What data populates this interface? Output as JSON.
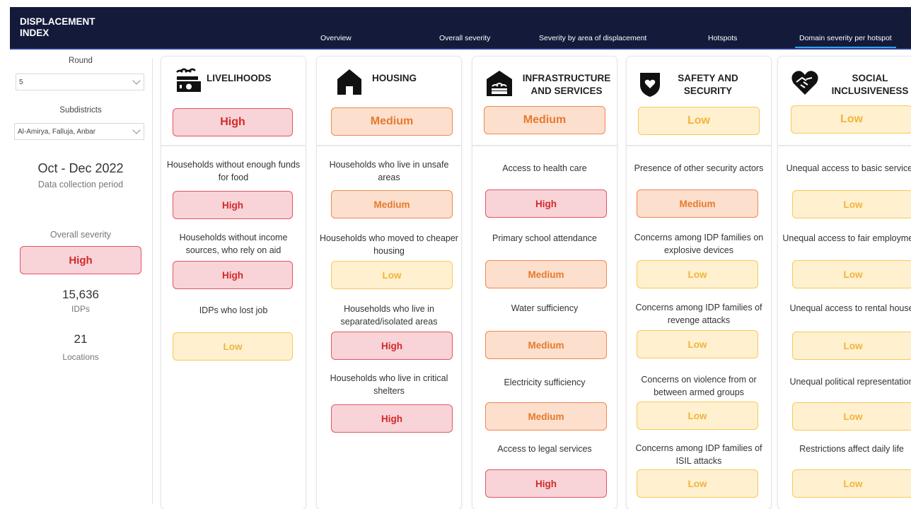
{
  "header": {
    "title_line1": "DISPLACEMENT",
    "title_line2": "INDEX",
    "tabs": [
      "Overview",
      "Overall severity",
      "Severity by area of displacement",
      "Hotspots",
      "Domain severity per hotspot"
    ],
    "active_tab": "Domain severity per hotspot"
  },
  "filters": {
    "round_label": "Round",
    "round_value": "5",
    "subdistricts_label": "Subdistricts",
    "subdistricts_value": "Al-Amirya, Falluja, Anbar"
  },
  "summary": {
    "period": "Oct - Dec 2022",
    "period_label": "Data collection period",
    "overall_label": "Overall severity",
    "overall_value": "High",
    "idps_value": "15,636",
    "idps_label": "IDPs",
    "locations_value": "21",
    "locations_label": "Locations"
  },
  "domains": [
    {
      "title_line1": "LIVELIHOODS",
      "title_line2": "",
      "severity": "High",
      "icon": "money-wheat-icon",
      "indicators": [
        {
          "text": "Households without enough funds for food",
          "value": "High"
        },
        {
          "text": "Households without income sources, who rely on aid",
          "value": "High"
        },
        {
          "text": "IDPs who lost job",
          "value": "Low"
        }
      ]
    },
    {
      "title_line1": "HOUSING",
      "title_line2": "",
      "severity": "Medium",
      "icon": "house-icon",
      "indicators": [
        {
          "text": "Households who live in unsafe areas",
          "value": "Medium"
        },
        {
          "text": "Households who moved to cheaper housing",
          "value": "Low"
        },
        {
          "text": "Households who live in separated/isolated areas",
          "value": "High"
        },
        {
          "text": "Households who live in critical shelters",
          "value": "High"
        }
      ]
    },
    {
      "title_line1": "INFRASTRUCTURE",
      "title_line2": "AND SERVICES",
      "severity": "Medium",
      "icon": "infrastructure-icon",
      "indicators": [
        {
          "text": "Access to health care",
          "value": "High"
        },
        {
          "text": "Primary school attendance",
          "value": "Medium"
        },
        {
          "text": "Water sufficiency",
          "value": "Medium"
        },
        {
          "text": "Electricity sufficiency",
          "value": "Medium"
        },
        {
          "text": "Access to legal services",
          "value": "High"
        }
      ]
    },
    {
      "title_line1": "SAFETY AND",
      "title_line2": "SECURITY",
      "severity": "Low",
      "icon": "shield-heart-icon",
      "indicators": [
        {
          "text": "Presence of other security actors",
          "value": "Medium"
        },
        {
          "text": "Concerns among IDP families on explosive devices",
          "value": "Low"
        },
        {
          "text": "Concerns among IDP families of revenge attacks",
          "value": "Low"
        },
        {
          "text": "Concerns on violence from or between armed groups",
          "value": "Low"
        },
        {
          "text": "Concerns among IDP families of ISIL attacks",
          "value": "Low"
        }
      ]
    },
    {
      "title_line1": "SOCIAL",
      "title_line2": "INCLUSIVENESS",
      "severity": "Low",
      "icon": "handshake-heart-icon",
      "indicators": [
        {
          "text": "Unequal access to basic services",
          "value": "Low"
        },
        {
          "text": "Unequal access to fair employment",
          "value": "Low"
        },
        {
          "text": "Unequal access to rental house",
          "value": "Low"
        },
        {
          "text": "Unequal political representation",
          "value": "Low"
        },
        {
          "text": "Restrictions affect daily life",
          "value": "Low"
        }
      ]
    }
  ],
  "colors": {
    "high": "#d12a2a",
    "medium": "#e57a2e",
    "low": "#f1b43b",
    "header_bg": "#141a3a"
  }
}
